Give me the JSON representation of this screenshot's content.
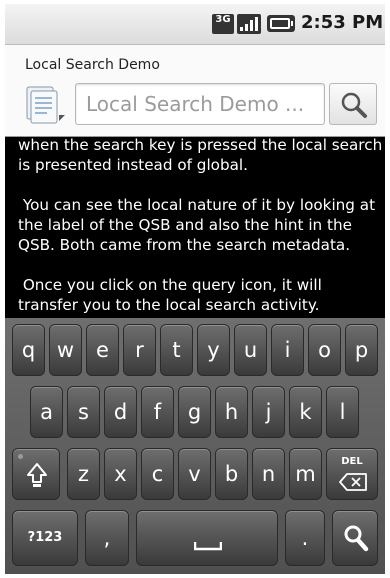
{
  "status_bar": {
    "network_label": "3G",
    "time": "2:53 PM",
    "icons": [
      "network-3g-icon",
      "signal-bars-icon",
      "battery-icon"
    ]
  },
  "search": {
    "label": "Local Search Demo",
    "placeholder": "Local Search Demo ...",
    "value": "",
    "search_button_icon": "magnifier-icon"
  },
  "content": {
    "paragraphs": [
      "when the search key is pressed the local search is presented instead of global.",
      " You can see the local nature of it by looking at the label of the QSB and also the hint in the QSB. Both came from the search metadata.",
      " Once you click on the query icon, it will transfer you to the local search activity."
    ]
  },
  "keyboard": {
    "row1": [
      "q",
      "w",
      "e",
      "r",
      "t",
      "y",
      "u",
      "i",
      "o",
      "p"
    ],
    "row2": [
      "a",
      "s",
      "d",
      "f",
      "g",
      "h",
      "j",
      "k",
      "l"
    ],
    "row3": [
      "z",
      "x",
      "c",
      "v",
      "b",
      "n",
      "m"
    ],
    "shift_icon": "shift-arrow-icon",
    "del_label": "DEL",
    "symbols_label": "?123",
    "comma_label": ",",
    "period_label": ".",
    "space_icon": "space-bar-icon",
    "search_icon": "magnifier-icon"
  },
  "colors": {
    "screen_background": "#000000",
    "key_face": "#4a4a4a",
    "key_text": "#ffffff"
  }
}
